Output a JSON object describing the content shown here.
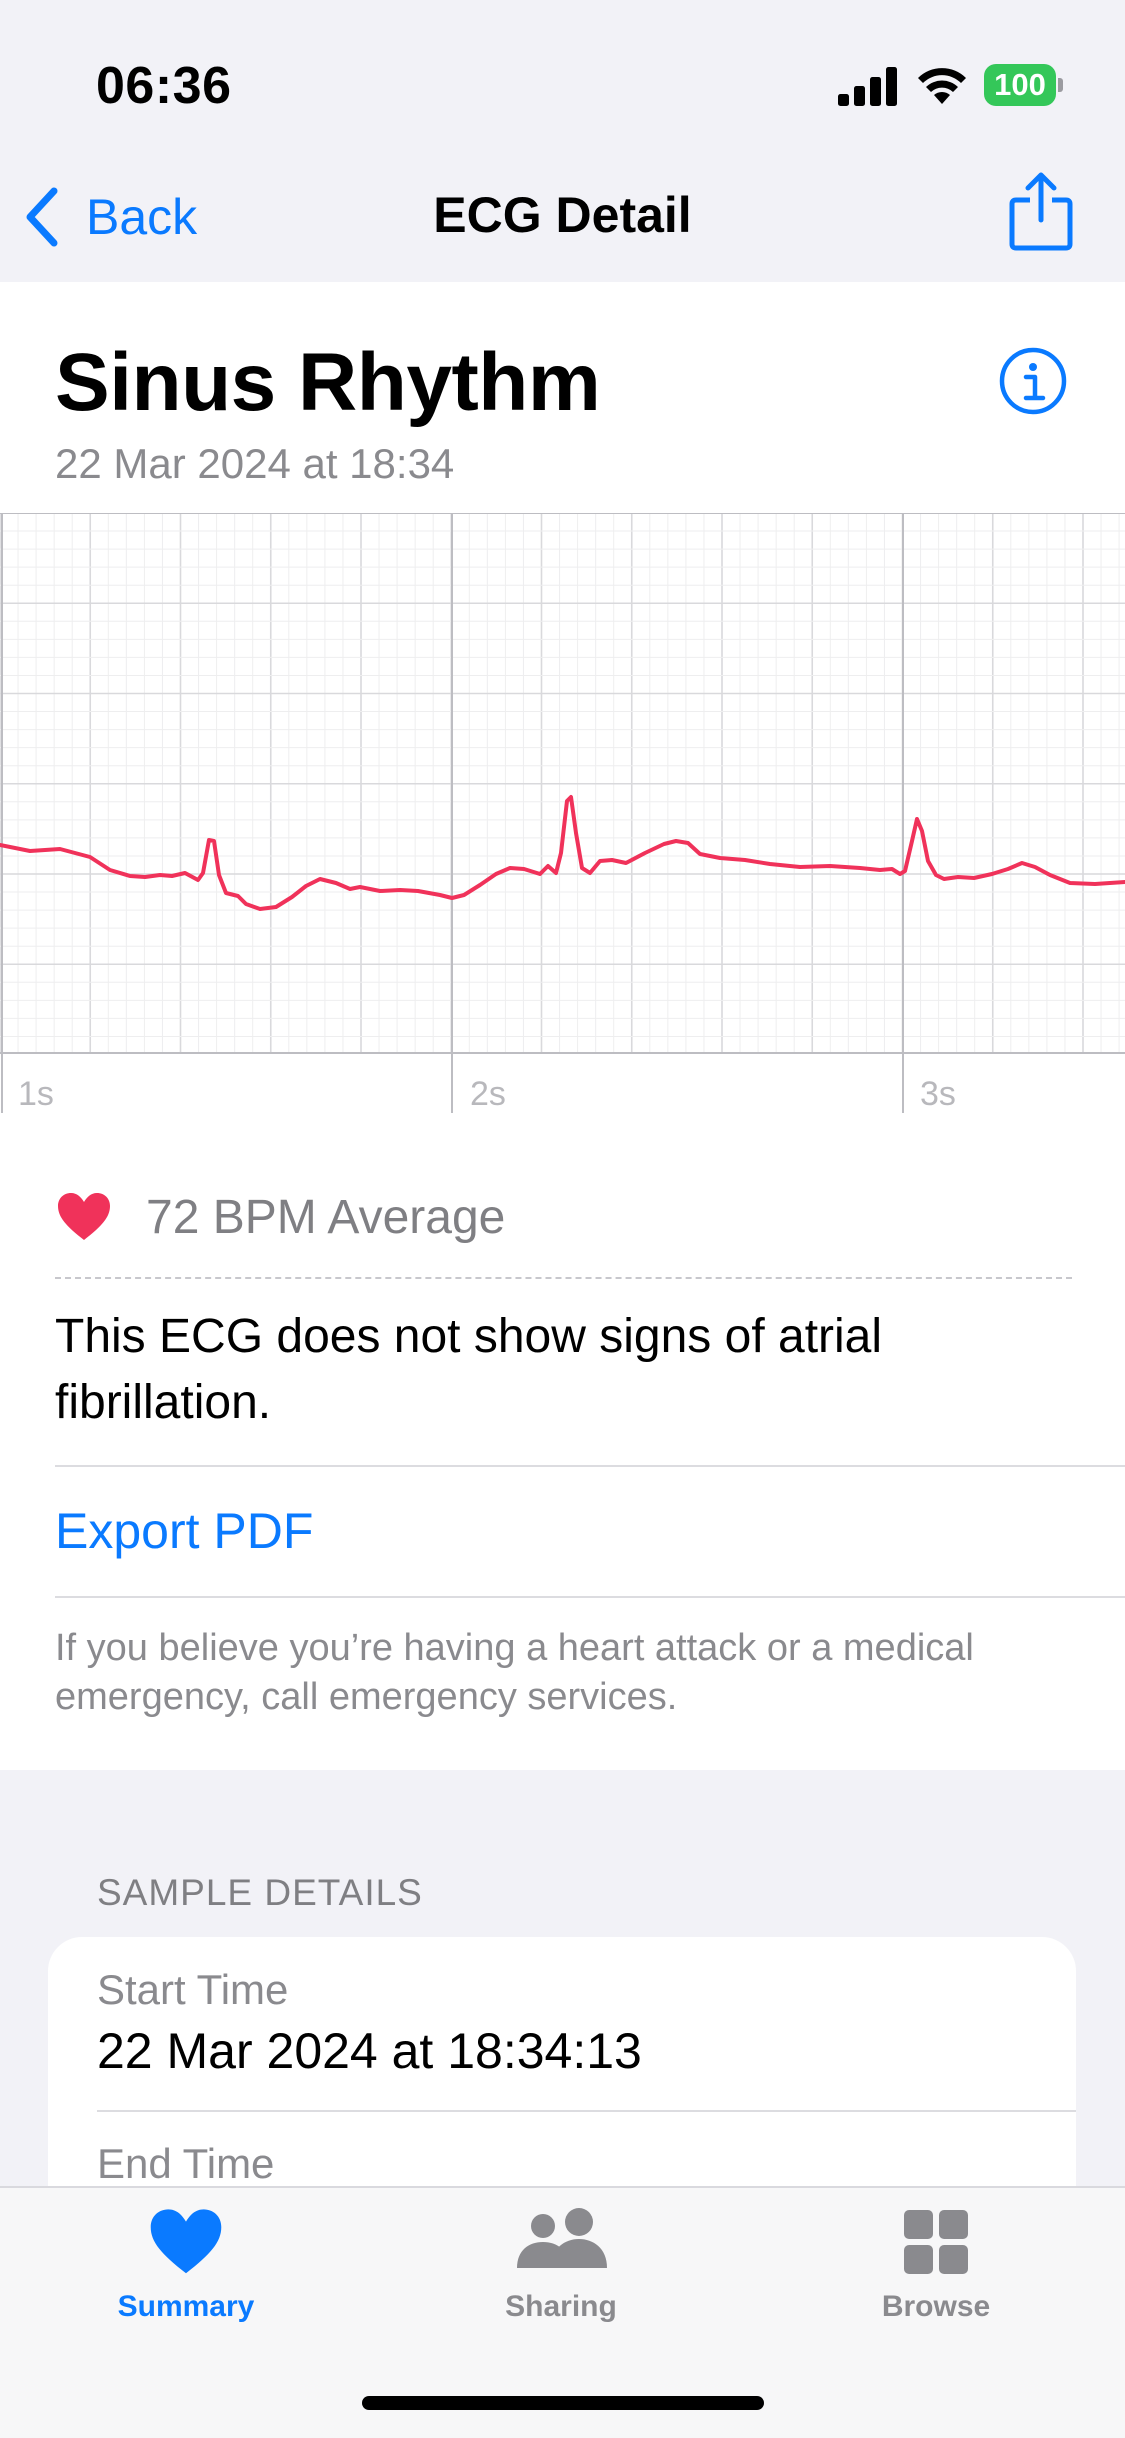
{
  "status_bar": {
    "time": "06:36",
    "battery": "100"
  },
  "nav": {
    "back_label": "Back",
    "title": "ECG Detail"
  },
  "header": {
    "title": "Sinus Rhythm",
    "date": "22 Mar 2024 at 18:34"
  },
  "ecg": {
    "time_labels": [
      "1s",
      "2s",
      "3s"
    ],
    "trace_color": "#f0325a"
  },
  "summary": {
    "bpm": "72 BPM Average",
    "result": "This ECG does not show signs of atrial fibrillation.",
    "export_label": "Export PDF",
    "emergency": "If you believe you’re having a heart attack or a medical emergency, call emergency services."
  },
  "sample_details": {
    "header": "SAMPLE DETAILS",
    "start_label": "Start Time",
    "start_value": "22 Mar 2024 at 18:34:13",
    "end_label": "End Time"
  },
  "tabs": [
    {
      "label": "Summary",
      "icon": "heart-icon",
      "active": true
    },
    {
      "label": "Sharing",
      "icon": "people-icon",
      "active": false
    },
    {
      "label": "Browse",
      "icon": "grid-icon",
      "active": false
    }
  ],
  "colors": {
    "accent": "#0a7aff",
    "heart": "#f0325a",
    "battery": "#34c759"
  }
}
